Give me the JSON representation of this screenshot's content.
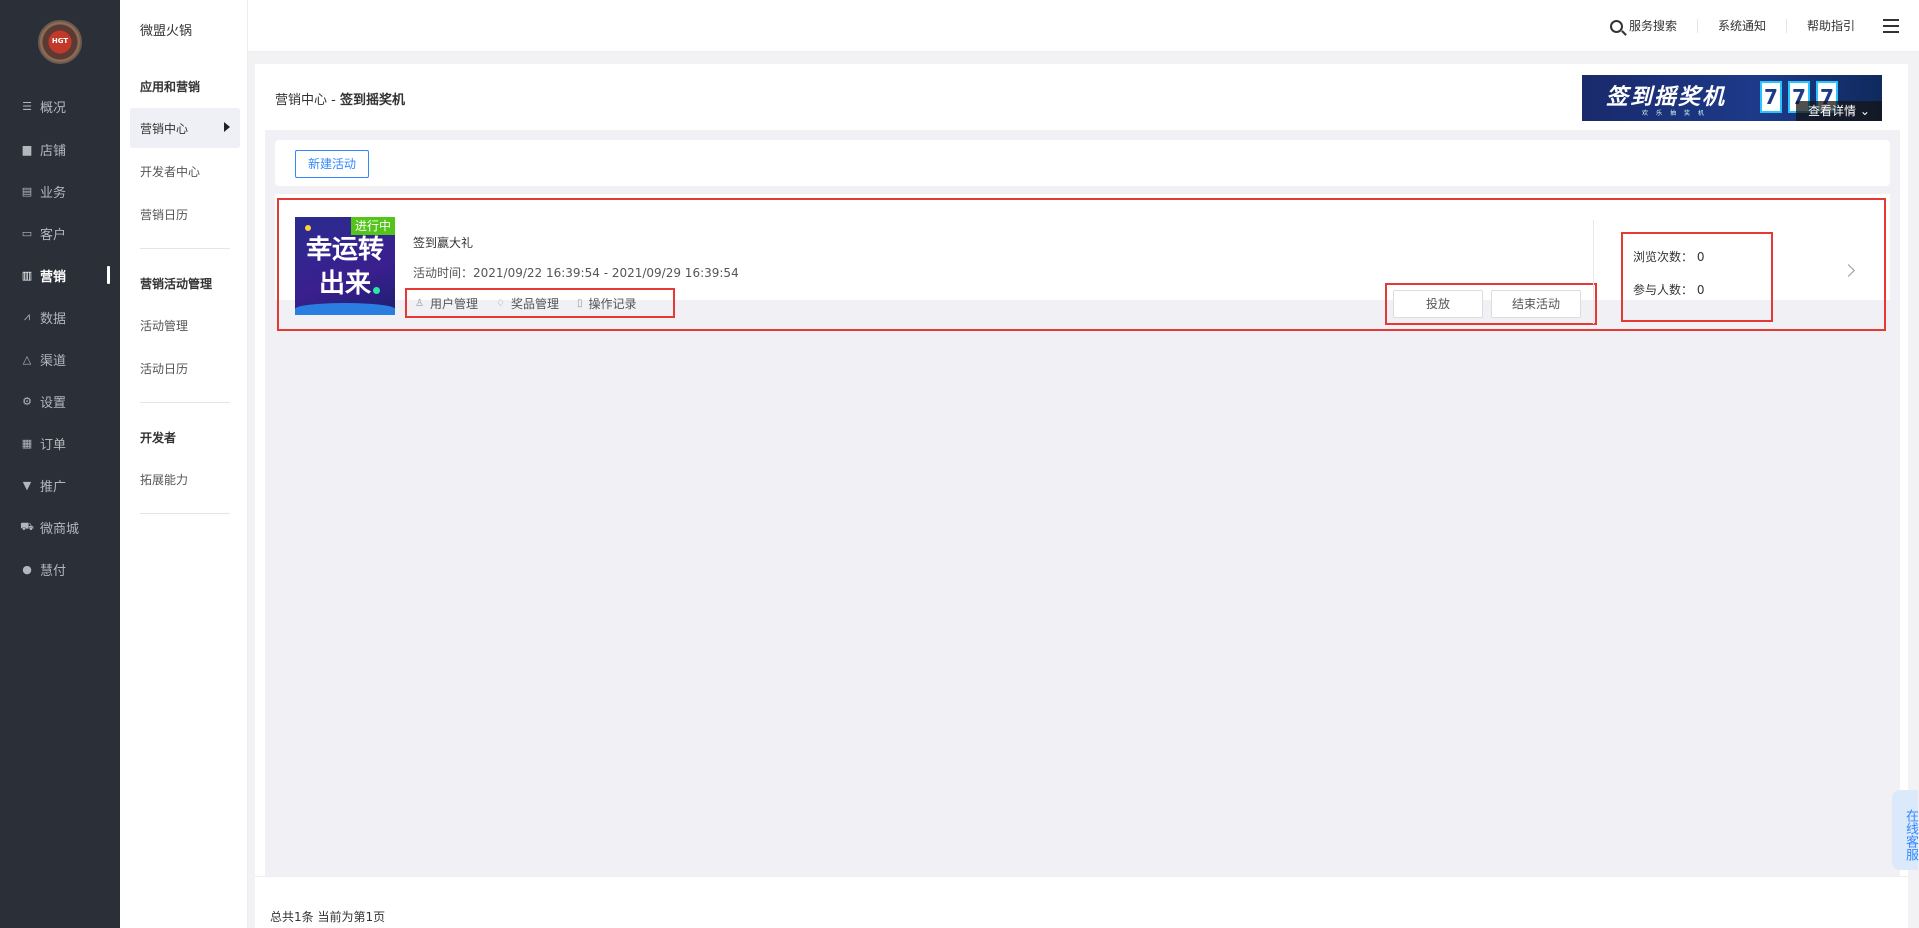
{
  "nav": {
    "items": [
      {
        "label": "概况",
        "icon": "overview-icon"
      },
      {
        "label": "店铺",
        "icon": "store-icon"
      },
      {
        "label": "业务",
        "icon": "business-icon"
      },
      {
        "label": "客户",
        "icon": "customer-icon"
      },
      {
        "label": "营销",
        "icon": "marketing-icon",
        "active": true
      },
      {
        "label": "数据",
        "icon": "data-icon"
      },
      {
        "label": "渠道",
        "icon": "channel-icon"
      },
      {
        "label": "设置",
        "icon": "settings-icon"
      },
      {
        "label": "订单",
        "icon": "order-icon"
      },
      {
        "label": "推广",
        "icon": "promote-icon"
      },
      {
        "label": "微商城",
        "icon": "mall-icon"
      },
      {
        "label": "慧付",
        "icon": "pay-icon"
      }
    ],
    "logo_text": "HGT"
  },
  "subnav": {
    "shop_name": "微盟火锅",
    "group1": "应用和营销",
    "item_center": "营销中心",
    "item_dev_center": "开发者中心",
    "item_calendar": "营销日历",
    "group2": "营销活动管理",
    "item_activity_mgmt": "活动管理",
    "item_activity_calendar": "活动日历",
    "group3": "开发者",
    "item_extend": "拓展能力"
  },
  "topbar": {
    "search": "服务搜索",
    "notice": "系统通知",
    "help": "帮助指引"
  },
  "page": {
    "crumb_prefix": "营销中心 - ",
    "crumb_current": "签到摇奖机",
    "banner_title": "签到摇奖机",
    "banner_sub": "欢乐抽奖机",
    "banner_slots": [
      "7",
      "7",
      "7"
    ],
    "banner_more": "查看详情",
    "new_button": "新建活动"
  },
  "activity": {
    "status": "进行中",
    "thumb_text": "幸运转出来",
    "title": "签到赢大礼",
    "time": "活动时间：2021/09/22 16:39:54 - 2021/09/29 16:39:54",
    "link_users": "用户管理",
    "link_prizes": "奖品管理",
    "link_logs": "操作记录",
    "btn_launch": "投放",
    "btn_end": "结束活动",
    "views_label": "浏览次数：",
    "views_value": "0",
    "participants_label": "参与人数：",
    "participants_value": "0"
  },
  "footer": {
    "summary": "总共1条 当前为第1页"
  },
  "service": {
    "label": "在线客服"
  },
  "colors": {
    "nav_bg": "#2b2f38",
    "accent": "#3388ff",
    "status_green": "#52c41a",
    "highlight_red": "#e53935"
  }
}
